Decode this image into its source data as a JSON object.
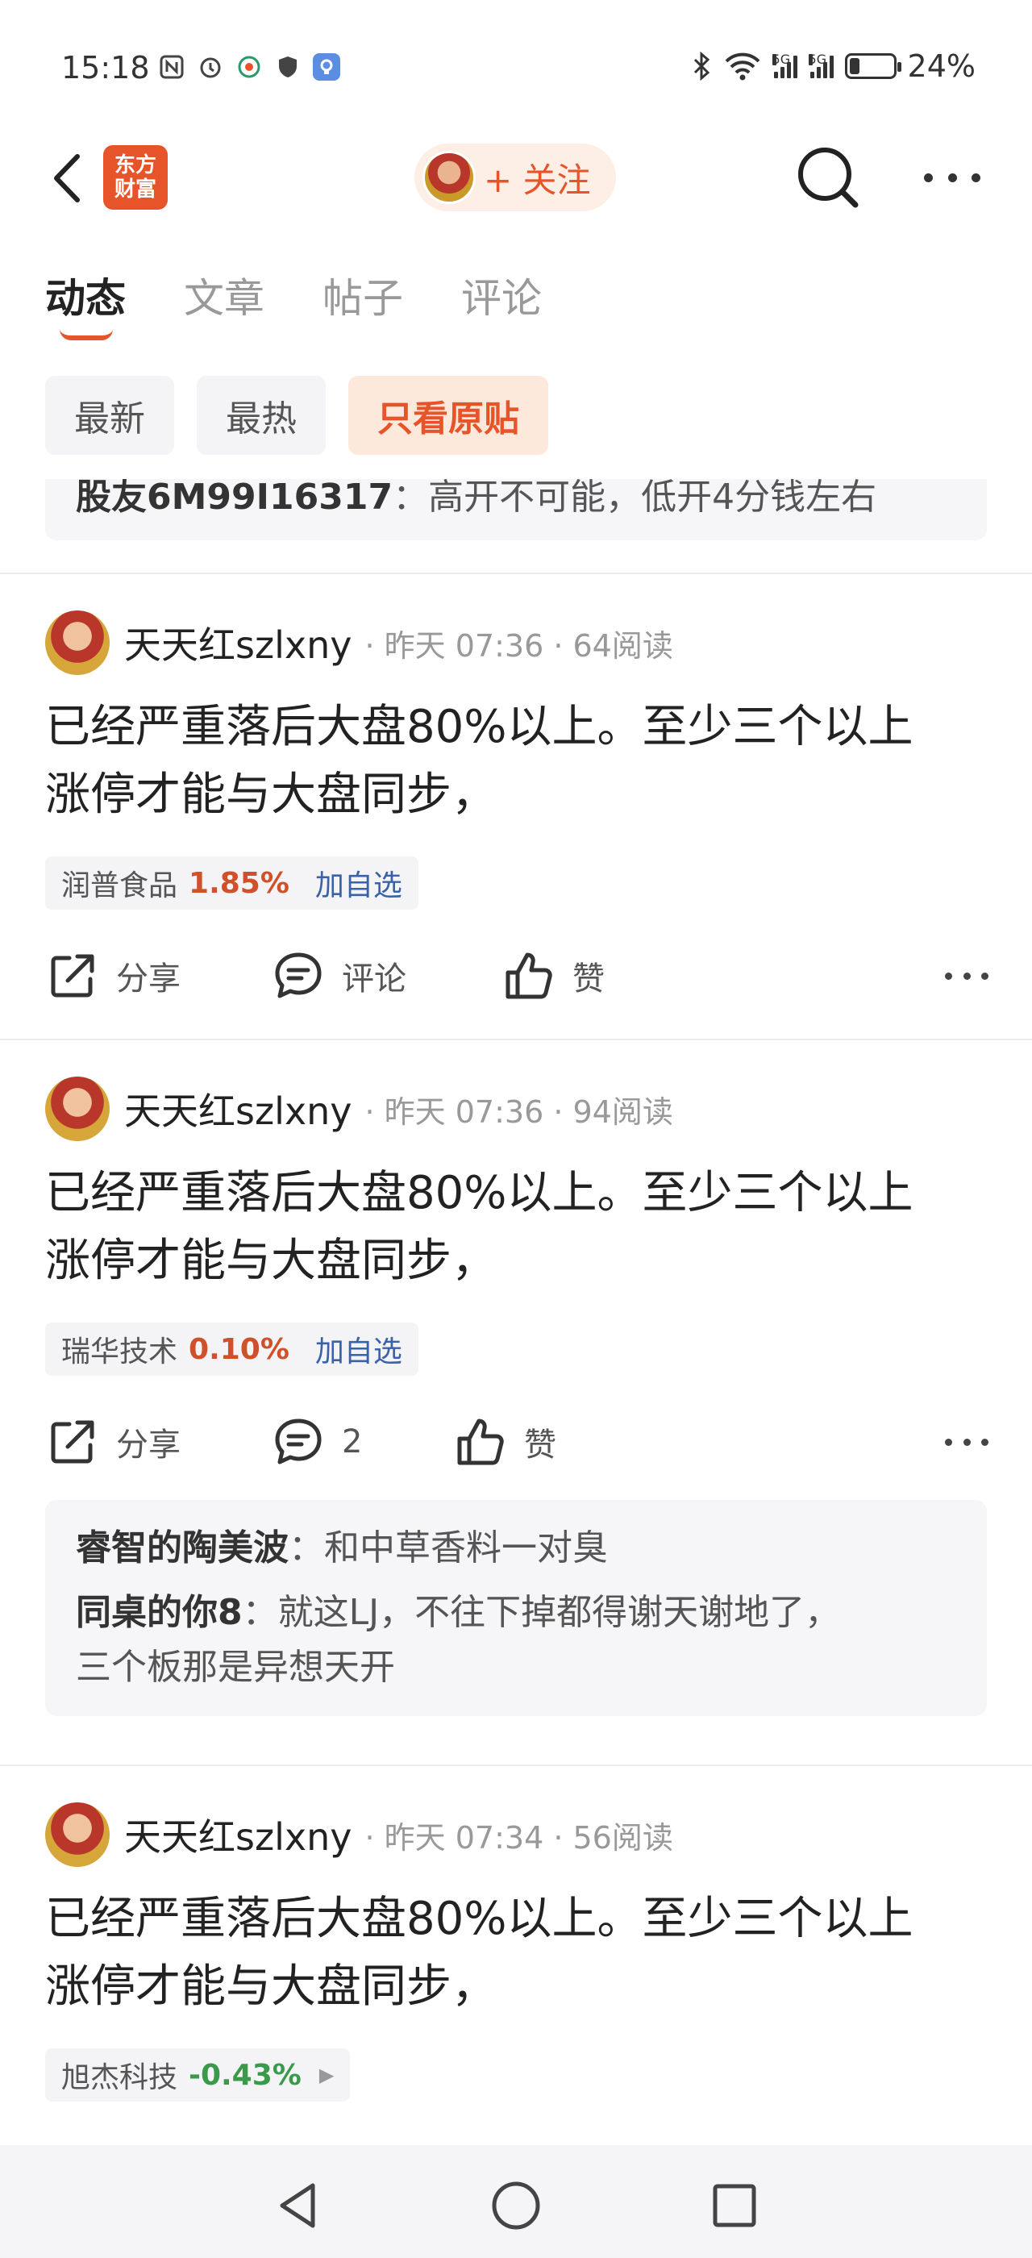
{
  "status_bar": {
    "time": "15:18",
    "battery": "24%",
    "battery_level": 0.24,
    "network_1": "5G",
    "network_2": "5G"
  },
  "header": {
    "logo_line1": "东方",
    "logo_line2": "财富",
    "follow_label": "+ 关注"
  },
  "tabs": [
    {
      "label": "动态",
      "active": true
    },
    {
      "label": "文章",
      "active": false
    },
    {
      "label": "帖子",
      "active": false
    },
    {
      "label": "评论",
      "active": false
    }
  ],
  "filters": [
    {
      "label": "最新",
      "active": false
    },
    {
      "label": "最热",
      "active": false
    },
    {
      "label": "只看原贴",
      "active": true
    }
  ],
  "clipped_comment": {
    "user": "股友6M99I16317",
    "text": "：高开不可能，低开4分钱左右"
  },
  "posts": [
    {
      "author": "天天红szlxny",
      "meta": "· 昨天 07:36 · 64阅读",
      "line1": "已经严重落后大盘80%以上。至少三个以上",
      "line2": "涨停才能与大盘同步，",
      "stock_name": "润普食品",
      "stock_pct": "1.85%",
      "add_watch": "加自选",
      "share": "分享",
      "comment": "评论",
      "like": "赞"
    },
    {
      "author": "天天红szlxny",
      "meta": "· 昨天 07:36 · 94阅读",
      "line1": "已经严重落后大盘80%以上。至少三个以上",
      "line2": "涨停才能与大盘同步，",
      "stock_name": "瑞华技术",
      "stock_pct": "0.10%",
      "add_watch": "加自选",
      "share": "分享",
      "comment": "2",
      "like": "赞",
      "comments": [
        {
          "user": "睿智的陶美波",
          "text": "：和中草香料一对臭"
        },
        {
          "user": "同桌的你8",
          "text": "：就这LJ，不往下掉都得谢天谢地了，",
          "text2": "三个板那是异想天开"
        }
      ]
    },
    {
      "author": "天天红szlxny",
      "meta": "· 昨天 07:34 · 56阅读",
      "line1": "已经严重落后大盘80%以上。至少三个以上",
      "line2": "涨停才能与大盘同步，",
      "stock_name": "旭杰科技",
      "stock_pct": "-0.43%"
    }
  ],
  "colors": {
    "accent": "#e8542a",
    "stock_up": "#d0502a",
    "stock_down": "#3a9a4a",
    "link": "#3a62a8"
  }
}
